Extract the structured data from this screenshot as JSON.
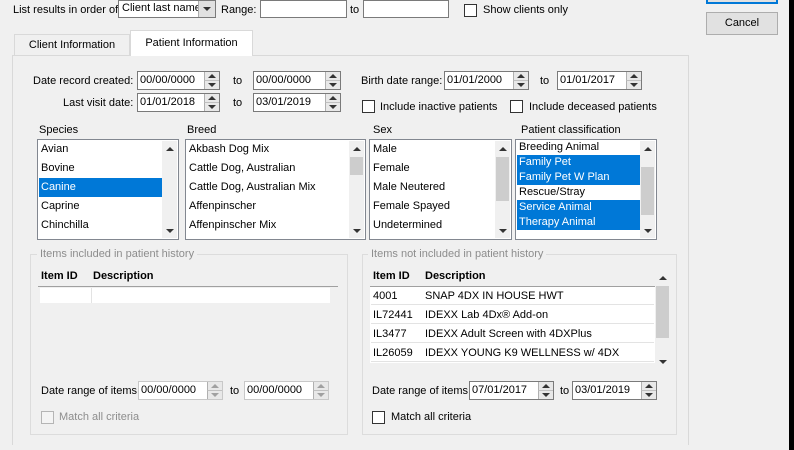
{
  "top": {
    "order_label": "List results in order of:",
    "order_value": "Client last name",
    "range_label": "Range:",
    "range_from": "",
    "to_label": "to",
    "range_to": "",
    "show_clients_label": "Show clients only"
  },
  "buttons": {
    "ok": "",
    "cancel": "Cancel"
  },
  "tabs": [
    {
      "label": "Client Information",
      "active": false
    },
    {
      "label": "Patient Information",
      "active": true
    }
  ],
  "dates": {
    "record_created_label": "Date record created:",
    "record_created_from": "00/00/0000",
    "record_created_to": "00/00/0000",
    "last_visit_label": "Last visit date:",
    "last_visit_from": "01/01/2018",
    "last_visit_to": "03/01/2019",
    "birth_label": "Birth date range:",
    "birth_from": "01/01/2000",
    "birth_to": "01/01/2017",
    "to": "to"
  },
  "include_inactive_label": "Include inactive patients",
  "include_deceased_label": "Include deceased patients",
  "species": {
    "label": "Species",
    "items": [
      "Avian",
      "Bovine",
      "Canine",
      "Caprine",
      "Chinchilla"
    ],
    "selected": [
      2
    ]
  },
  "breed": {
    "label": "Breed",
    "items": [
      "Akbash Dog Mix",
      "Cattle Dog, Australian",
      "Cattle Dog, Australian Mix",
      "Affenpinscher",
      "Affenpinscher Mix"
    ]
  },
  "sex": {
    "label": "Sex",
    "items": [
      "Male",
      "Female",
      "Male Neutered",
      "Female Spayed",
      "Undetermined"
    ]
  },
  "classification": {
    "label": "Patient classification",
    "items": [
      "Breeding Animal",
      "Family Pet",
      "Family Pet W Plan",
      "Rescue/Stray",
      "Service Animal",
      "Therapy Animal"
    ],
    "selected": [
      1,
      2,
      4,
      5
    ]
  },
  "included": {
    "title": "Items included in patient history",
    "col_id": "Item ID",
    "col_desc": "Description",
    "rows": [],
    "date_label": "Date range of items:",
    "date_from": "00/00/0000",
    "to": "to",
    "date_to": "00/00/0000",
    "match_label": "Match all criteria"
  },
  "excluded": {
    "title": "Items not included in patient history",
    "col_id": "Item ID",
    "col_desc": "Description",
    "rows": [
      {
        "id": "4001",
        "desc": "SNAP 4DX IN HOUSE HWT"
      },
      {
        "id": "IL72441",
        "desc": "IDEXX Lab 4Dx® Add-on"
      },
      {
        "id": "IL3477",
        "desc": "IDEXX Adult Screen with 4DXPlus"
      },
      {
        "id": "IL26059",
        "desc": "IDEXX YOUNG K9 WELLNESS w/ 4DX"
      }
    ],
    "date_label": "Date range of items:",
    "date_from": "07/01/2017",
    "to": "to",
    "date_to": "03/01/2019",
    "match_label": "Match all criteria"
  },
  "colors": {
    "selection": "#0078d7",
    "background": "#f0f0f0",
    "disabled_text": "#8d8d8d"
  }
}
